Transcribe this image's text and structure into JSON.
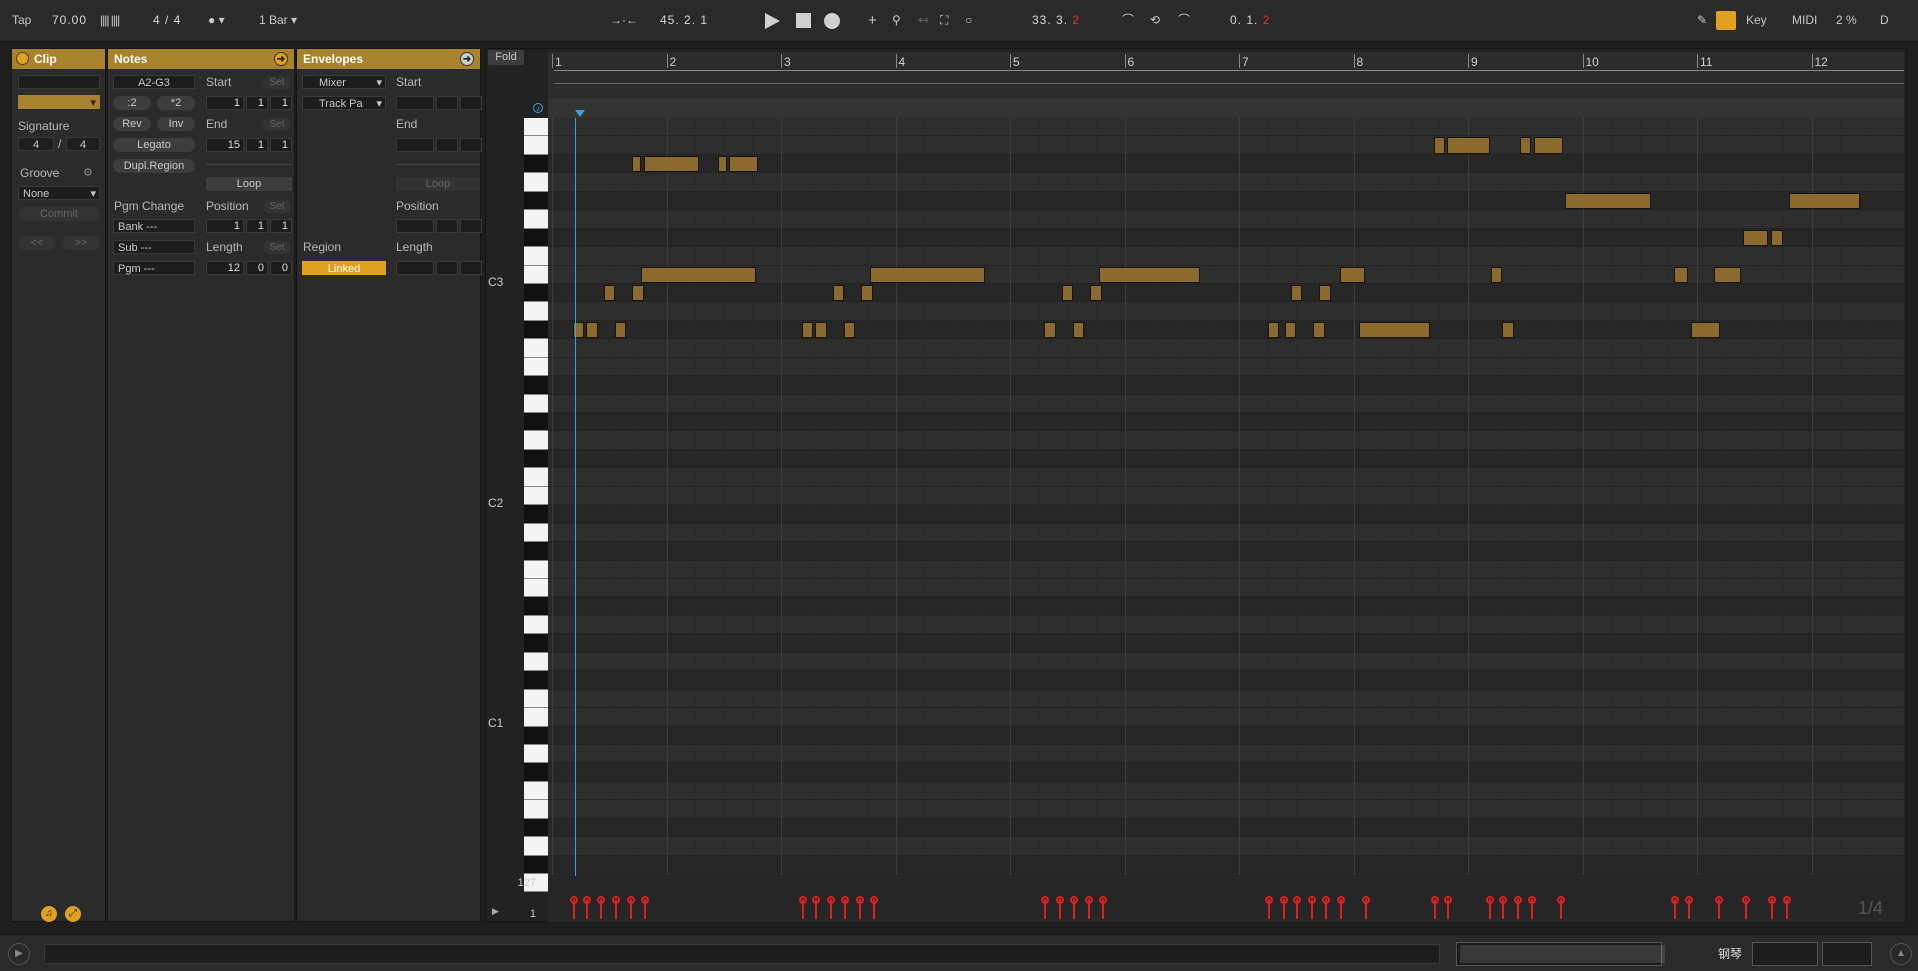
{
  "transport": {
    "tap": "Tap",
    "tempo": "70.00",
    "nudge": "|||| ||||",
    "signature": "4 / 4",
    "metronome": "●",
    "quantize": "1 Bar",
    "position": "45. 2. 1",
    "loop_start_a": "33. 3.",
    "loop_start_b": "2",
    "loop_len_a": "0. 1.",
    "loop_len_b": "2",
    "key": "Key",
    "midi": "MIDI",
    "cpu": "2 %",
    "d": "D"
  },
  "clip": {
    "title": "Clip",
    "signature_label": "Signature",
    "sig_num": "4",
    "sig_slash": "/",
    "sig_den": "4",
    "groove_label": "Groove",
    "groove_value": "None",
    "commit": "Commit",
    "prev": "<<",
    "next": ">>"
  },
  "notes": {
    "title": "Notes",
    "range": "A2-G3",
    "half": ":2",
    "double": "*2",
    "rev": "Rev",
    "inv": "Inv",
    "legato": "Legato",
    "dupl": "Dupl.Region",
    "pgm_change": "Pgm Change",
    "bank": "Bank ---",
    "sub": "Sub ---",
    "pgm": "Pgm ---",
    "start_label": "Start",
    "end_label": "End",
    "loop": "Loop",
    "position_label": "Position",
    "length_label": "Length",
    "set": "Set",
    "start": [
      "1",
      "1",
      "1"
    ],
    "end": [
      "15",
      "1",
      "1"
    ],
    "position": [
      "1",
      "1",
      "1"
    ],
    "length": [
      "12",
      "0",
      "0"
    ]
  },
  "envelopes": {
    "title": "Envelopes",
    "device": "Mixer",
    "control": "Track Pa",
    "start_label": "Start",
    "end_label": "End",
    "loop": "Loop",
    "position_label": "Position",
    "region_label": "Region",
    "linked": "Linked",
    "length_label": "Length"
  },
  "editor": {
    "fold": "Fold",
    "bars": [
      "1",
      "2",
      "3",
      "4",
      "5",
      "6",
      "7",
      "8",
      "9",
      "10",
      "11",
      "12"
    ],
    "octave_labels": [
      "C3",
      "C2",
      "C1"
    ],
    "vel_max": "127",
    "vel_min": "1",
    "grid": "1/4",
    "notes": [
      {
        "pitch": "A#3",
        "start": 1.7,
        "len": 0.08
      },
      {
        "pitch": "A#3",
        "start": 1.8,
        "len": 0.48
      },
      {
        "pitch": "A#3",
        "start": 2.45,
        "len": 0.08
      },
      {
        "pitch": "A#3",
        "start": 2.55,
        "len": 0.25
      },
      {
        "pitch": "G#3",
        "start": 9.85,
        "len": 0.75
      },
      {
        "pitch": "G#3",
        "start": 11.8,
        "len": 0.62
      },
      {
        "pitch": "F#3",
        "start": 11.4,
        "len": 0.22
      },
      {
        "pitch": "F#3",
        "start": 11.65,
        "len": 0.1
      },
      {
        "pitch": "E3",
        "start": 1.78,
        "len": 1.0
      },
      {
        "pitch": "E3",
        "start": 3.78,
        "len": 1.0
      },
      {
        "pitch": "E3",
        "start": 5.78,
        "len": 0.88
      },
      {
        "pitch": "E3",
        "start": 7.88,
        "len": 0.22
      },
      {
        "pitch": "E3",
        "start": 9.2,
        "len": 0.1
      },
      {
        "pitch": "E3",
        "start": 10.8,
        "len": 0.12
      },
      {
        "pitch": "E3",
        "start": 11.15,
        "len": 0.23
      },
      {
        "pitch": "D#3",
        "start": 1.45,
        "len": 0.1
      },
      {
        "pitch": "D#3",
        "start": 1.7,
        "len": 0.1
      },
      {
        "pitch": "D#3",
        "start": 3.45,
        "len": 0.1
      },
      {
        "pitch": "D#3",
        "start": 3.7,
        "len": 0.1
      },
      {
        "pitch": "D#3",
        "start": 5.45,
        "len": 0.1
      },
      {
        "pitch": "D#3",
        "start": 5.7,
        "len": 0.1
      },
      {
        "pitch": "D#3",
        "start": 7.45,
        "len": 0.1
      },
      {
        "pitch": "D#3",
        "start": 7.7,
        "len": 0.1
      },
      {
        "pitch": "C#3",
        "start": 1.18,
        "len": 0.1
      },
      {
        "pitch": "C#3",
        "start": 1.3,
        "len": 0.1
      },
      {
        "pitch": "C#3",
        "start": 1.55,
        "len": 0.1
      },
      {
        "pitch": "C#3",
        "start": 3.18,
        "len": 0.1
      },
      {
        "pitch": "C#3",
        "start": 3.3,
        "len": 0.1
      },
      {
        "pitch": "C#3",
        "start": 3.55,
        "len": 0.1
      },
      {
        "pitch": "C#3",
        "start": 5.3,
        "len": 0.1
      },
      {
        "pitch": "C#3",
        "start": 5.55,
        "len": 0.1
      },
      {
        "pitch": "C#3",
        "start": 7.25,
        "len": 0.1
      },
      {
        "pitch": "C#3",
        "start": 7.4,
        "len": 0.1
      },
      {
        "pitch": "C#3",
        "start": 7.65,
        "len": 0.1
      },
      {
        "pitch": "C#3",
        "start": 8.05,
        "len": 0.62
      },
      {
        "pitch": "C#3",
        "start": 9.3,
        "len": 0.1
      },
      {
        "pitch": "C#3",
        "start": 10.95,
        "len": 0.25
      },
      {
        "pitch": "B3",
        "start": 8.7,
        "len": 0.1
      },
      {
        "pitch": "B3",
        "start": 8.82,
        "len": 0.37
      },
      {
        "pitch": "B3",
        "start": 9.45,
        "len": 0.1
      },
      {
        "pitch": "B3",
        "start": 9.58,
        "len": 0.25
      }
    ],
    "velocities": [
      1.18,
      1.3,
      1.42,
      1.55,
      1.68,
      1.8,
      3.18,
      3.3,
      3.43,
      3.55,
      3.68,
      3.8,
      5.3,
      5.43,
      5.55,
      5.68,
      5.8,
      7.25,
      7.38,
      7.5,
      7.63,
      7.75,
      7.88,
      8.1,
      8.7,
      8.82,
      9.18,
      9.3,
      9.43,
      9.55,
      9.8,
      10.8,
      10.92,
      11.18,
      11.42,
      11.65,
      11.78
    ]
  },
  "status": {
    "track_name": "钢琴"
  }
}
